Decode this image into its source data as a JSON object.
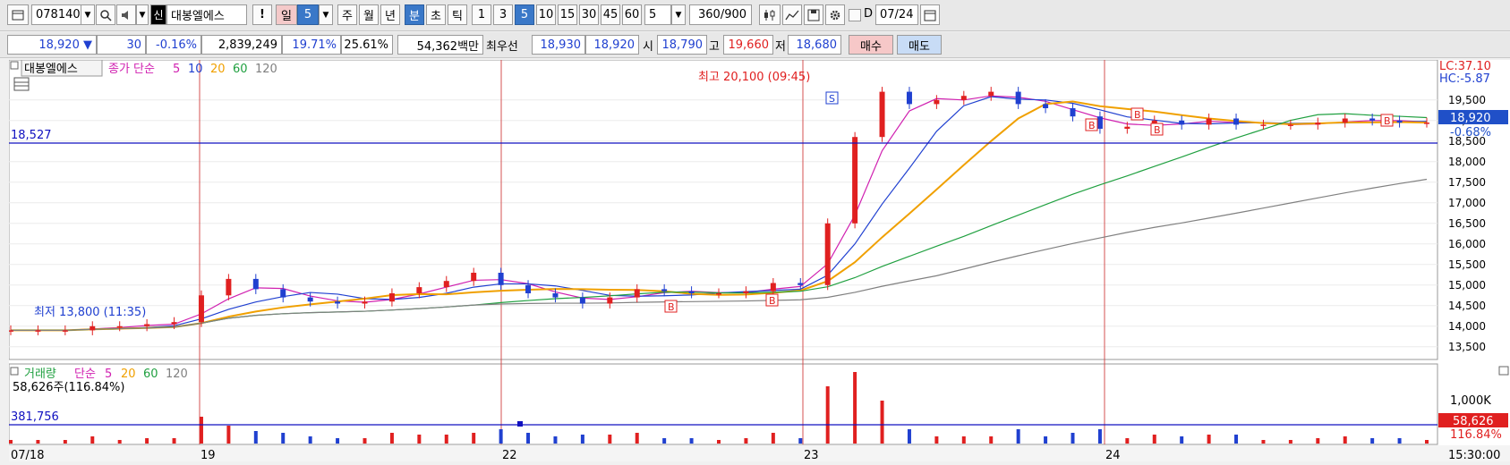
{
  "toolbar": {
    "code": "078140",
    "badge": "신",
    "stock_name": "대봉엘에스",
    "excl": "!",
    "period_day": "일",
    "period_day_num": "5",
    "week": "주",
    "month": "월",
    "year": "년",
    "minute": "분",
    "sec": "초",
    "tick": "틱",
    "intervals": [
      "1",
      "3",
      "5",
      "10",
      "15",
      "30",
      "45",
      "60"
    ],
    "interval_selected": "5",
    "custom_interval": "5",
    "view_count": "360",
    "view_total": "/900",
    "d_label": "D",
    "date": "07/24"
  },
  "info": {
    "price": "18,920",
    "change_arrow": "▼",
    "change": "30",
    "change_pct": "-0.16%",
    "volume": "2,839,249",
    "pct1": "19.71%",
    "pct2": "25.61%",
    "amount": "54,362백만",
    "best_label": "최우선",
    "best_ask": "18,930",
    "best_bid": "18,920",
    "open_label": "시",
    "open": "18,790",
    "high_label": "고",
    "high": "19,660",
    "low_label": "저",
    "low": "18,680",
    "buy": "매수",
    "sell": "매도"
  },
  "price_panel": {
    "legend_name": "대봉엘에스",
    "legend_ma": "종가 단순",
    "legend_periods": [
      "5",
      "10",
      "20",
      "60",
      "120"
    ],
    "ref_line_label": "18,527",
    "ref_line_value": 18527,
    "max_annotation": "최고 20,100 (09:45)",
    "min_annotation": "최저 13,800 (11:35)",
    "lc": "LC:37.10",
    "hc": "HC:-5.87",
    "last_price_tag": "18,920",
    "last_pct_tag": "-0.68%",
    "signal_S": "S",
    "signal_B": "B"
  },
  "volume_panel": {
    "legend_name": "거래량",
    "legend_ma": "단순",
    "legend_periods": [
      "5",
      "20",
      "60",
      "120"
    ],
    "current": "58,626주(116.84%)",
    "ref_line_label": "381,756",
    "axis_label": "1,000K",
    "last_vol_tag": "58,626",
    "last_pct_tag": "116.84%"
  },
  "time_axis": {
    "labels": [
      "07/18",
      "19",
      "22",
      "23",
      "24"
    ],
    "current_time": "15:30:00"
  },
  "colors": {
    "ma5": "#d020b0",
    "ma10": "#2040d0",
    "ma20": "#f0a000",
    "ma60": "#20a040",
    "ma120": "#808080",
    "up": "#e02020",
    "down": "#2040d0",
    "ref_line": "#1010c0",
    "selected_tab": "#3a78c8"
  },
  "chart_data": {
    "type": "candlestick",
    "title": "",
    "x": [
      "07/18",
      "19",
      "22",
      "23",
      "24"
    ],
    "ylim": [
      13300,
      20300
    ],
    "y_ticks": [
      13500,
      14000,
      14500,
      15000,
      15500,
      16000,
      16500,
      17000,
      17500,
      18000,
      18500,
      19000,
      19500
    ],
    "y_tick_labels": [
      "13,500",
      "14,000",
      "14,500",
      "15,000",
      "15,500",
      "16,000",
      "16,500",
      "17,000",
      "17,500",
      "18,000",
      "18,500",
      "19,000",
      "19,500"
    ],
    "series": [
      {
        "name": "종가",
        "values": [
          13900,
          13900,
          13900,
          14000,
          14000,
          14050,
          14100,
          14750,
          15150,
          14900,
          14700,
          14600,
          14550,
          14600,
          14800,
          14950,
          15100,
          15300,
          15000,
          14800,
          14700,
          14550,
          14700,
          14900,
          14850,
          14800,
          14800,
          14850,
          15050,
          15000,
          16500,
          18600,
          19700,
          19400,
          19500,
          19600,
          19700,
          19400,
          19300,
          19100,
          18800,
          18850,
          19000,
          18900,
          19050,
          18900,
          18900,
          18900,
          18950,
          19050,
          19000,
          18950,
          18950
        ]
      }
    ]
  }
}
